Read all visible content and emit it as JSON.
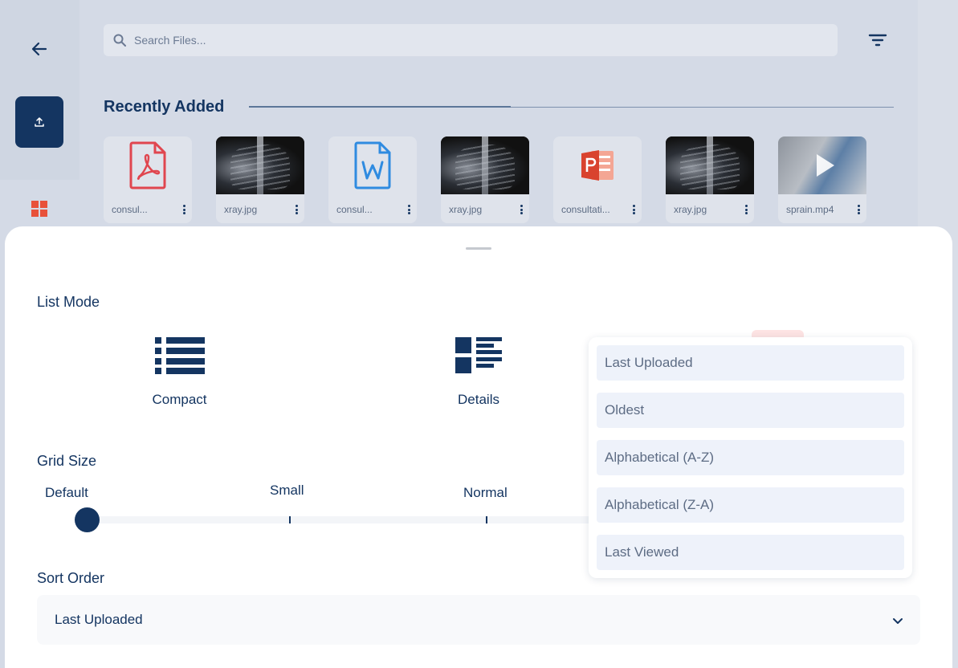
{
  "search": {
    "placeholder": "Search Files..."
  },
  "recent": {
    "title": "Recently Added",
    "files": [
      {
        "name": "consul...",
        "type": "pdf-icon"
      },
      {
        "name": "xray.jpg",
        "type": "xray-image"
      },
      {
        "name": "consul...",
        "type": "word-icon"
      },
      {
        "name": "xray.jpg",
        "type": "xray-image"
      },
      {
        "name": "consultati...",
        "type": "powerpoint-icon"
      },
      {
        "name": "xray.jpg",
        "type": "xray-image"
      },
      {
        "name": "sprain.mp4",
        "type": "video-thumbnail"
      }
    ]
  },
  "sheet": {
    "list_mode": {
      "title": "List Mode",
      "compact": "Compact",
      "details": "Details"
    },
    "grid_size": {
      "title": "Grid Size",
      "default": "Default",
      "small": "Small",
      "normal": "Normal",
      "selected": "Default"
    },
    "sort_order": {
      "title": "Sort Order",
      "selected": "Last Uploaded",
      "options": [
        "Last Uploaded",
        "Oldest",
        "Alphabetical (A-Z)",
        "Alphabetical (Z-A)",
        "Last Viewed"
      ]
    }
  },
  "colors": {
    "primary": "#143561",
    "pdf": "#e0464f",
    "word": "#2f8be0",
    "powerpoint": "#d9432e",
    "background": "#d4dae6"
  }
}
